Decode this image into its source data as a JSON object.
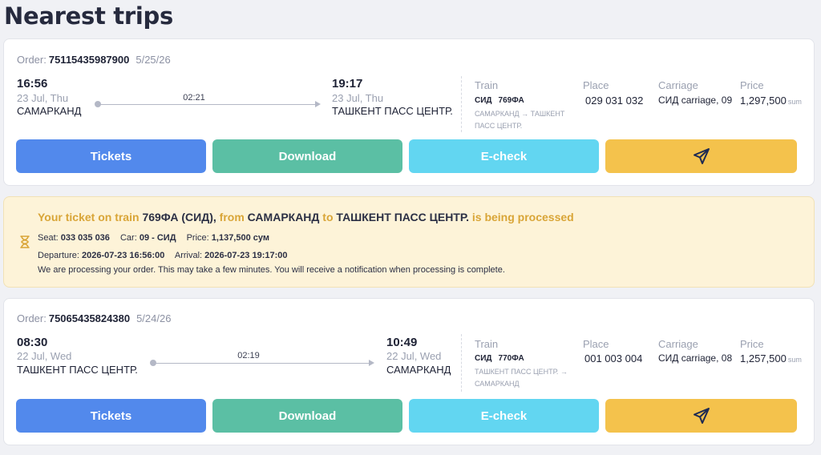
{
  "page": {
    "title": "Nearest trips"
  },
  "colors": {
    "tickets": "#5289ec",
    "download": "#5bbfa4",
    "echeck": "#62d6f1",
    "telegram": "#f4c24c",
    "notice_bg": "#fdf3d8",
    "notice_accent": "#d9a537"
  },
  "trips": [
    {
      "order_label": "Order:",
      "order_number": "75115435987900",
      "order_date": "5/25/26",
      "departure": {
        "time": "16:56",
        "date": "23 Jul, Thu",
        "station": "САМАРКАНД"
      },
      "arrival": {
        "time": "19:17",
        "date": "23 Jul, Thu",
        "station": "ТАШКЕНТ ПАСС ЦЕНТР."
      },
      "duration": "02:21",
      "train": {
        "label": "Train",
        "brand": "СИД",
        "number": "769ФА",
        "route": "САМАРКАНД → ТАШКЕНТ ПАСС ЦЕНТР."
      },
      "place": {
        "label": "Place",
        "value": "029 031 032"
      },
      "carriage": {
        "label": "Carriage",
        "value": "СИД carriage, 09"
      },
      "price": {
        "label": "Price",
        "value": "1,297,500",
        "currency": "sum"
      },
      "buttons": {
        "tickets": "Tickets",
        "download": "Download",
        "echeck": "E-check",
        "telegram_icon": "paper-plane-icon"
      }
    },
    {
      "order_label": "Order:",
      "order_number": "75065435824380",
      "order_date": "5/24/26",
      "departure": {
        "time": "08:30",
        "date": "22 Jul, Wed",
        "station": "ТАШКЕНТ ПАСС ЦЕНТР."
      },
      "arrival": {
        "time": "10:49",
        "date": "22 Jul, Wed",
        "station": "САМАРКАНД"
      },
      "duration": "02:19",
      "train": {
        "label": "Train",
        "brand": "СИД",
        "number": "770ФА",
        "route": "ТАШКЕНТ ПАСС ЦЕНТР. → САМАРКАНД"
      },
      "place": {
        "label": "Place",
        "value": "001 003 004"
      },
      "carriage": {
        "label": "Carriage",
        "value": "СИД carriage, 08"
      },
      "price": {
        "label": "Price",
        "value": "1,257,500",
        "currency": "sum"
      },
      "buttons": {
        "tickets": "Tickets",
        "download": "Download",
        "echeck": "E-check",
        "telegram_icon": "paper-plane-icon"
      }
    }
  ],
  "notice": {
    "icon": "hourglass-icon",
    "title_prefix": "Your ticket  on train",
    "train": "769ФА (СИД),",
    "from_word": "from",
    "from_station": "САМАРКАНД",
    "to_word": "to",
    "to_station": "ТАШКЕНТ ПАСС ЦЕНТР.",
    "status": "is being processed",
    "seat_label": "Seat:",
    "seat_value": "033 035 036",
    "car_label": "Car:",
    "car_value": "09 - СИД",
    "price_label": "Price:",
    "price_value": "1,137,500 сум",
    "departure_label": "Departure:",
    "departure_value": "2026-07-23 16:56:00",
    "arrival_label": "Arrival:",
    "arrival_value": "2026-07-23 19:17:00",
    "message": "We are processing your order. This may take a few minutes. You will receive a notification when processing is complete."
  }
}
